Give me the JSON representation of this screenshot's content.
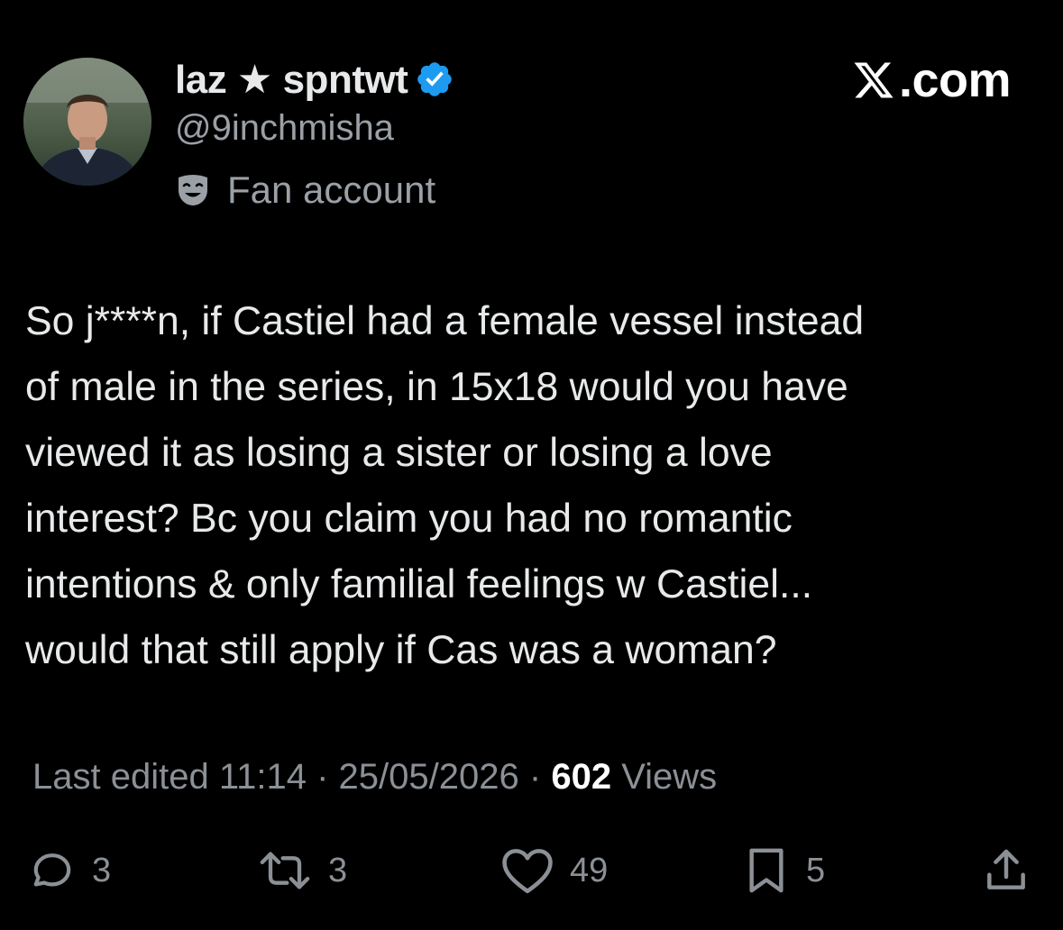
{
  "author": {
    "display_name": "laz ★ spntwt",
    "handle": "@9inchmisha",
    "label": "Fan account",
    "verified": true,
    "badge_color": "#1d9bf0",
    "avatar_icon": "profile-photo"
  },
  "brand": {
    "text": ".com",
    "icon": "x-logo-icon"
  },
  "tweet": {
    "text": "So j****n, if Castiel had a female vessel instead\nof male in the series, in 15x18 would you have\nviewed it as losing a sister or losing a love\ninterest? Bc you claim you had no romantic\nintentions & only familial feelings w Castiel...\nwould that still apply if Cas was a woman?"
  },
  "meta": {
    "edited_prefix": "Last edited",
    "time": "11:14",
    "date": "25/05/2026",
    "separator": "·",
    "views_count": "602",
    "views_label": "Views"
  },
  "actions": {
    "replies": "3",
    "reposts": "3",
    "likes": "49",
    "bookmarks": "5"
  },
  "colors": {
    "background": "#000000",
    "primary_text": "#e7e9ea",
    "secondary_text": "#8b9096",
    "accent_blue": "#1d9bf0"
  }
}
